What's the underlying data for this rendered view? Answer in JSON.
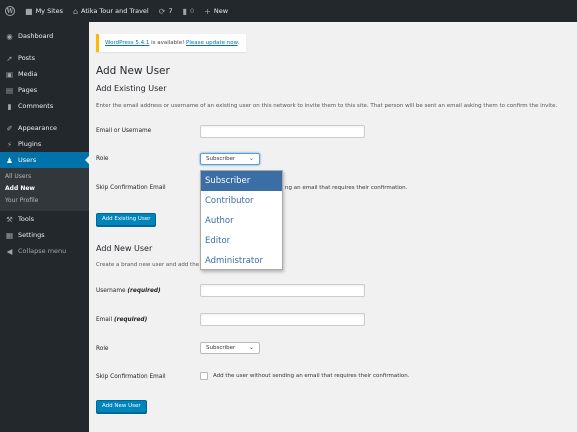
{
  "adminbar": {
    "my_sites": "My Sites",
    "site_name": "Atika Tour and Travel",
    "updates_count": "7",
    "comments_count": "0",
    "new_label": "New"
  },
  "sidebar": {
    "items": [
      {
        "label": "Dashboard",
        "icon": "dashboard-icon"
      },
      {
        "label": "Posts",
        "icon": "pin-icon"
      },
      {
        "label": "Media",
        "icon": "media-icon"
      },
      {
        "label": "Pages",
        "icon": "page-icon"
      },
      {
        "label": "Comments",
        "icon": "comment-icon"
      },
      {
        "label": "Appearance",
        "icon": "brush-icon"
      },
      {
        "label": "Plugins",
        "icon": "plug-icon"
      },
      {
        "label": "Users",
        "icon": "user-icon"
      },
      {
        "label": "Tools",
        "icon": "wrench-icon"
      },
      {
        "label": "Settings",
        "icon": "settings-icon"
      },
      {
        "label": "Collapse menu",
        "icon": "collapse-icon"
      }
    ],
    "submenu": [
      "All Users",
      "Add New",
      "Your Profile"
    ]
  },
  "notice": {
    "text_before": "WordPress 5.4.1",
    "text_middle": " is available! ",
    "link": "Please update now",
    "text_after": "."
  },
  "page": {
    "title": "Add New User",
    "existing": {
      "heading": "Add Existing User",
      "description": "Enter the email address or username of an existing user on this network to invite them to this site. That person will be sent an email asking them to confirm the invite.",
      "email_label": "Email or Username",
      "email_value": "",
      "role_label": "Role",
      "role_value": "Subscriber",
      "skip_label": "Skip Confirmation Email",
      "skip_text_visible": "ng an email that requires their confirmation.",
      "button": "Add Existing User"
    },
    "new": {
      "heading": "Add New User",
      "description_visible": "Create a brand new user and add the",
      "username_label": "Username",
      "username_required": "(required)",
      "email_label": "Email",
      "email_required": "(required)",
      "role_label": "Role",
      "role_value": "Subscriber",
      "skip_label": "Skip Confirmation Email",
      "skip_text": "Add the user without sending an email that requires their confirmation.",
      "button": "Add New User"
    }
  },
  "dropdown": {
    "options": [
      "Subscriber",
      "Contributor",
      "Author",
      "Editor",
      "Administrator"
    ],
    "selected": "Subscriber"
  }
}
